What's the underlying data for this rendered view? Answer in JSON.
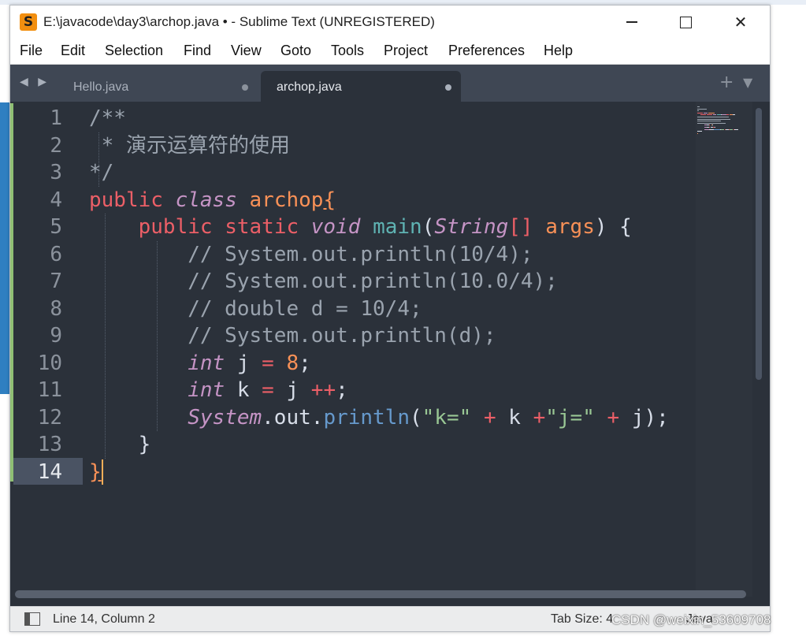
{
  "window": {
    "title": "E:\\javacode\\day3\\archop.java • - Sublime Text (UNREGISTERED)",
    "app_icon": "S"
  },
  "menu": [
    "File",
    "Edit",
    "Selection",
    "Find",
    "View",
    "Goto",
    "Tools",
    "Project",
    "Preferences",
    "Help"
  ],
  "tabs": [
    {
      "label": "Hello.java",
      "active": false,
      "dirty": true
    },
    {
      "label": "archop.java",
      "active": true,
      "dirty": true
    }
  ],
  "tab_controls": {
    "nav": "◀ ▶",
    "plus": "+",
    "dropdown": "▼"
  },
  "editor": {
    "line_numbers": [
      "1",
      "2",
      "3",
      "4",
      "5",
      "6",
      "7",
      "8",
      "9",
      "10",
      "11",
      "12",
      "13",
      "14"
    ],
    "active_line": 14,
    "lines": [
      [
        {
          "t": "/**",
          "c": "com"
        }
      ],
      [
        {
          "t": " * 演示运算符的使用",
          "c": "com"
        }
      ],
      [
        {
          "t": "*/",
          "c": "com"
        }
      ],
      [
        {
          "t": "public",
          "c": "kw"
        },
        {
          "t": " ",
          "c": "pl"
        },
        {
          "t": "class",
          "c": "st"
        },
        {
          "t": " ",
          "c": "pl"
        },
        {
          "t": "archop",
          "c": "cls"
        },
        {
          "t": "{",
          "c": "br"
        }
      ],
      [
        {
          "t": "    ",
          "c": "pl"
        },
        {
          "t": "public",
          "c": "kw"
        },
        {
          "t": " ",
          "c": "pl"
        },
        {
          "t": "static",
          "c": "kw"
        },
        {
          "t": " ",
          "c": "pl"
        },
        {
          "t": "void",
          "c": "st"
        },
        {
          "t": " ",
          "c": "pl"
        },
        {
          "t": "main",
          "c": "fn2"
        },
        {
          "t": "(",
          "c": "pl"
        },
        {
          "t": "String",
          "c": "st"
        },
        {
          "t": "[]",
          "c": "op"
        },
        {
          "t": " ",
          "c": "pl"
        },
        {
          "t": "args",
          "c": "cls"
        },
        {
          "t": ") {",
          "c": "pl"
        }
      ],
      [
        {
          "t": "        // System.out.println(10/4);",
          "c": "com"
        }
      ],
      [
        {
          "t": "        // System.out.println(10.0/4);",
          "c": "com"
        }
      ],
      [
        {
          "t": "        // double d = 10/4;",
          "c": "com"
        }
      ],
      [
        {
          "t": "        // System.out.println(d);",
          "c": "com"
        }
      ],
      [
        {
          "t": "        ",
          "c": "pl"
        },
        {
          "t": "int",
          "c": "st"
        },
        {
          "t": " j ",
          "c": "pl"
        },
        {
          "t": "=",
          "c": "op"
        },
        {
          "t": " ",
          "c": "pl"
        },
        {
          "t": "8",
          "c": "num"
        },
        {
          "t": ";",
          "c": "pl"
        }
      ],
      [
        {
          "t": "        ",
          "c": "pl"
        },
        {
          "t": "int",
          "c": "st"
        },
        {
          "t": " k ",
          "c": "pl"
        },
        {
          "t": "=",
          "c": "op"
        },
        {
          "t": " j ",
          "c": "pl"
        },
        {
          "t": "++",
          "c": "op"
        },
        {
          "t": ";",
          "c": "pl"
        }
      ],
      [
        {
          "t": "        ",
          "c": "pl"
        },
        {
          "t": "System",
          "c": "st"
        },
        {
          "t": ".out.",
          "c": "pl"
        },
        {
          "t": "println",
          "c": "fn"
        },
        {
          "t": "(",
          "c": "pl"
        },
        {
          "t": "\"k=\"",
          "c": "str"
        },
        {
          "t": " ",
          "c": "pl"
        },
        {
          "t": "+",
          "c": "op"
        },
        {
          "t": " k ",
          "c": "pl"
        },
        {
          "t": "+",
          "c": "op"
        },
        {
          "t": "\"j=\"",
          "c": "str"
        },
        {
          "t": " ",
          "c": "pl"
        },
        {
          "t": "+",
          "c": "op"
        },
        {
          "t": " j);",
          "c": "pl"
        }
      ],
      [
        {
          "t": "    }",
          "c": "pl"
        }
      ],
      [
        {
          "t": "}",
          "c": "br"
        }
      ]
    ]
  },
  "status": {
    "position": "Line 14, Column 2",
    "tab_size": "Tab Size: 4",
    "syntax": "Java"
  },
  "watermark": "CSDN @weixin_53609708",
  "colors": {
    "editor_bg": "#2b313a",
    "tabbar_bg": "#3f4754",
    "keyword": "#ec5f67",
    "storage": "#c594c5",
    "class_name": "#f99157",
    "function": "#6699cc",
    "string": "#99c794",
    "comment": "#9aa3ae",
    "caret": "#f9ae58"
  }
}
